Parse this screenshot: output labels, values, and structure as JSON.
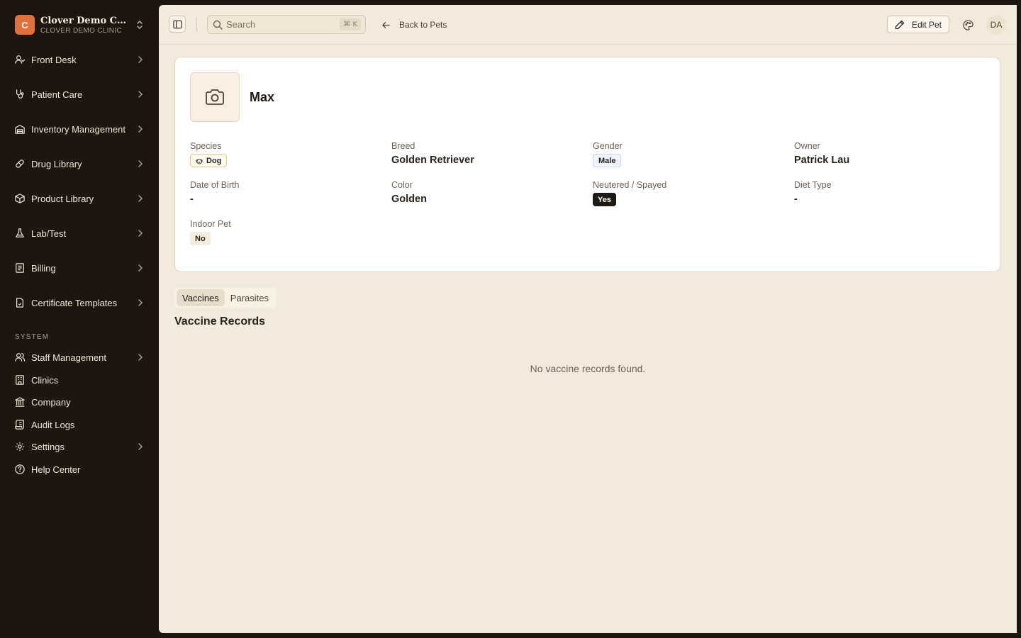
{
  "brand": {
    "logo_letter": "C",
    "name": "Clover Demo Clini...",
    "subtitle": "CLOVER DEMO CLINIC",
    "accent_color": "#e2703a"
  },
  "sidebar": {
    "items": [
      {
        "label": "Front Desk",
        "icon": "user-desk-icon",
        "has_children": true
      },
      {
        "label": "Patient Care",
        "icon": "stethoscope-icon",
        "has_children": true
      },
      {
        "label": "Inventory Management",
        "icon": "warehouse-icon",
        "has_children": true
      },
      {
        "label": "Drug Library",
        "icon": "pill-icon",
        "has_children": true
      },
      {
        "label": "Product Library",
        "icon": "package-icon",
        "has_children": true
      },
      {
        "label": "Lab/Test",
        "icon": "flask-icon",
        "has_children": true
      },
      {
        "label": "Billing",
        "icon": "receipt-icon",
        "has_children": true
      },
      {
        "label": "Certificate Templates",
        "icon": "certificate-icon",
        "has_children": true
      }
    ],
    "system_label": "SYSTEM",
    "system_items": [
      {
        "label": "Staff Management",
        "icon": "users-icon",
        "has_children": true
      },
      {
        "label": "Clinics",
        "icon": "building-icon",
        "has_children": false
      },
      {
        "label": "Company",
        "icon": "landmark-icon",
        "has_children": false
      },
      {
        "label": "Audit Logs",
        "icon": "scroll-icon",
        "has_children": false
      },
      {
        "label": "Settings",
        "icon": "gear-icon",
        "has_children": true
      },
      {
        "label": "Help Center",
        "icon": "help-circle-icon",
        "has_children": false
      }
    ]
  },
  "topbar": {
    "search_placeholder": "Search",
    "search_shortcut": "⌘ K",
    "back_label": "Back to Pets",
    "edit_label": "Edit Pet",
    "avatar_initials": "DA"
  },
  "pet": {
    "name": "Max",
    "fields": {
      "species": {
        "label": "Species",
        "value": "Dog"
      },
      "breed": {
        "label": "Breed",
        "value": "Golden Retriever"
      },
      "gender": {
        "label": "Gender",
        "value": "Male"
      },
      "owner": {
        "label": "Owner",
        "value": "Patrick Lau"
      },
      "dob": {
        "label": "Date of Birth",
        "value": "-"
      },
      "color": {
        "label": "Color",
        "value": "Golden"
      },
      "neutered": {
        "label": "Neutered / Spayed",
        "value": "Yes"
      },
      "diet": {
        "label": "Diet Type",
        "value": "-"
      },
      "indoor": {
        "label": "Indoor Pet",
        "value": "No"
      }
    }
  },
  "tabs": [
    {
      "label": "Vaccines",
      "active": true
    },
    {
      "label": "Parasites",
      "active": false
    }
  ],
  "records": {
    "title": "Vaccine Records",
    "empty_message": "No vaccine records found."
  }
}
